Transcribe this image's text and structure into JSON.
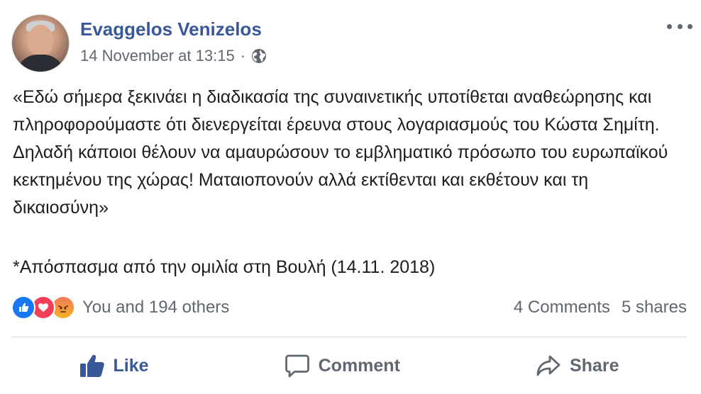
{
  "post": {
    "author": "Evaggelos Venizelos",
    "timestamp": "14 November at 13:15",
    "separator": "·",
    "privacy_icon": "globe-icon",
    "more_icon": "more-options-icon",
    "body": [
      "«Εδώ σήμερα ξεκινάει η διαδικασία της συναινετικής υποτίθεται αναθεώρησης και πληροφορούμαστε ότι διενεργείται έρευνα στους λογαριασμούς του Κώστα Σημίτη.",
      "Δηλαδή κάποιοι θέλουν να αμαυρώσουν το εμβληματικό πρόσωπο του ευρωπαϊκού κεκτημένου της χώρας! Ματαιοπονούν αλλά εκτίθενται και εκθέτουν και τη δικαιοσύνη»"
    ],
    "excerpt": "*Απόσπασμα από την ομιλία στη Βουλή (14.11. 2018)"
  },
  "reactions": {
    "icons": [
      "like-reaction-icon",
      "love-reaction-icon",
      "angry-reaction-icon"
    ],
    "summary": "You and 194 others",
    "comments": "4 Comments",
    "shares": "5 shares"
  },
  "actions": {
    "like": "Like",
    "comment": "Comment",
    "share": "Share"
  },
  "colors": {
    "author": "#385898",
    "like_active": "#385898",
    "muted": "#606770",
    "like_reaction": "#1877f2",
    "love_reaction": "#f33e58"
  }
}
